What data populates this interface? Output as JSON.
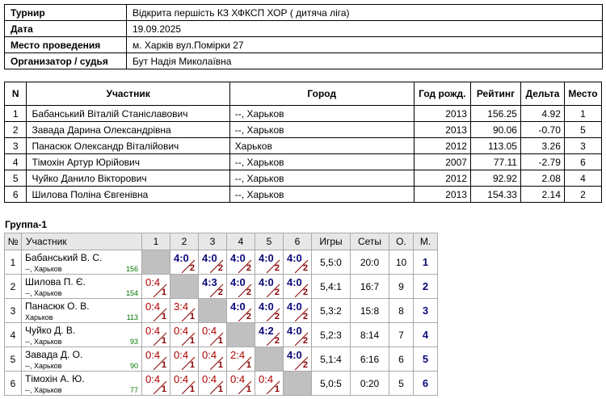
{
  "info": [
    {
      "label": "Турнир",
      "value": "Відкрита першість КЗ ХФКСП ХОР ( дитяча ліга)"
    },
    {
      "label": "Дата",
      "value": "19.09.2025"
    },
    {
      "label": "Место проведения",
      "value": "м. Харків вул.Помірки 27"
    },
    {
      "label": "Организатор / судья",
      "value": "Бут Надія Миколаївна"
    }
  ],
  "participants": {
    "headers": [
      "N",
      "Участник",
      "Город",
      "Год рожд.",
      "Рейтинг",
      "Дельта",
      "Место"
    ],
    "rows": [
      [
        "1",
        "Бабанський Віталій Станіславович",
        "--, Харьков",
        "2013",
        "156.25",
        "4.92",
        "1"
      ],
      [
        "2",
        "Завада Дарина Олександрівна",
        "--, Харьков",
        "2013",
        "90.06",
        "-0.70",
        "5"
      ],
      [
        "3",
        "Панасюк Олександр Віталійович",
        "Харьков",
        "2012",
        "113.05",
        "3.26",
        "3"
      ],
      [
        "4",
        "Тімохін Артур Юрійович",
        "--, Харьков",
        "2007",
        "77.11",
        "-2.79",
        "6"
      ],
      [
        "5",
        "Чуйко Данило Вікторович",
        "--, Харьков",
        "2012",
        "92.92",
        "2.08",
        "4"
      ],
      [
        "6",
        "Шилова Поліна Євгенівна",
        "--, Харьков",
        "2013",
        "154.33",
        "2.14",
        "2"
      ]
    ]
  },
  "group": {
    "title": "Группа-1",
    "headers": [
      "№",
      "Участник",
      "1",
      "2",
      "3",
      "4",
      "5",
      "6",
      "Игры",
      "Сеты",
      "О.",
      "М."
    ],
    "rows": [
      {
        "no": "1",
        "name": "Бабанський В. С.",
        "city": "--, Харьков",
        "rating": "156",
        "games": [
          null,
          [
            "4:0",
            "2",
            "w"
          ],
          [
            "4:0",
            "2",
            "w"
          ],
          [
            "4:0",
            "2",
            "w"
          ],
          [
            "4:0",
            "2",
            "w"
          ],
          [
            "4:0",
            "2",
            "w"
          ]
        ],
        "igry": "5,5:0",
        "sets": "20:0",
        "points": "10",
        "place": "1"
      },
      {
        "no": "2",
        "name": "Шилова П. Є.",
        "city": "--, Харьков",
        "rating": "154",
        "games": [
          [
            "0:4",
            "1",
            "l"
          ],
          null,
          [
            "4:3",
            "2",
            "w"
          ],
          [
            "4:0",
            "2",
            "w"
          ],
          [
            "4:0",
            "2",
            "w"
          ],
          [
            "4:0",
            "2",
            "w"
          ]
        ],
        "igry": "5,4:1",
        "sets": "16:7",
        "points": "9",
        "place": "2"
      },
      {
        "no": "3",
        "name": "Панасюк О. В.",
        "city": "Харьков",
        "rating": "113",
        "games": [
          [
            "0:4",
            "1",
            "l"
          ],
          [
            "3:4",
            "1",
            "l"
          ],
          null,
          [
            "4:0",
            "2",
            "w"
          ],
          [
            "4:0",
            "2",
            "w"
          ],
          [
            "4:0",
            "2",
            "w"
          ]
        ],
        "igry": "5,3:2",
        "sets": "15:8",
        "points": "8",
        "place": "3"
      },
      {
        "no": "4",
        "name": "Чуйко Д. В.",
        "city": "--, Харьков",
        "rating": "93",
        "games": [
          [
            "0:4",
            "1",
            "l"
          ],
          [
            "0:4",
            "1",
            "l"
          ],
          [
            "0:4",
            "1",
            "l"
          ],
          null,
          [
            "4:2",
            "2",
            "w"
          ],
          [
            "4:0",
            "2",
            "w"
          ]
        ],
        "igry": "5,2:3",
        "sets": "8:14",
        "points": "7",
        "place": "4"
      },
      {
        "no": "5",
        "name": "Завада Д. О.",
        "city": "--, Харьков",
        "rating": "90",
        "games": [
          [
            "0:4",
            "1",
            "l"
          ],
          [
            "0:4",
            "1",
            "l"
          ],
          [
            "0:4",
            "1",
            "l"
          ],
          [
            "2:4",
            "1",
            "l"
          ],
          null,
          [
            "4:0",
            "2",
            "w"
          ]
        ],
        "igry": "5,1:4",
        "sets": "6:16",
        "points": "6",
        "place": "5"
      },
      {
        "no": "6",
        "name": "Тімохін А. Ю.",
        "city": "--, Харьков",
        "rating": "77",
        "games": [
          [
            "0:4",
            "1",
            "l"
          ],
          [
            "0:4",
            "1",
            "l"
          ],
          [
            "0:4",
            "1",
            "l"
          ],
          [
            "0:4",
            "1",
            "l"
          ],
          [
            "0:4",
            "1",
            "l"
          ],
          null
        ],
        "igry": "5,0:5",
        "sets": "0:20",
        "points": "5",
        "place": "6"
      }
    ]
  }
}
